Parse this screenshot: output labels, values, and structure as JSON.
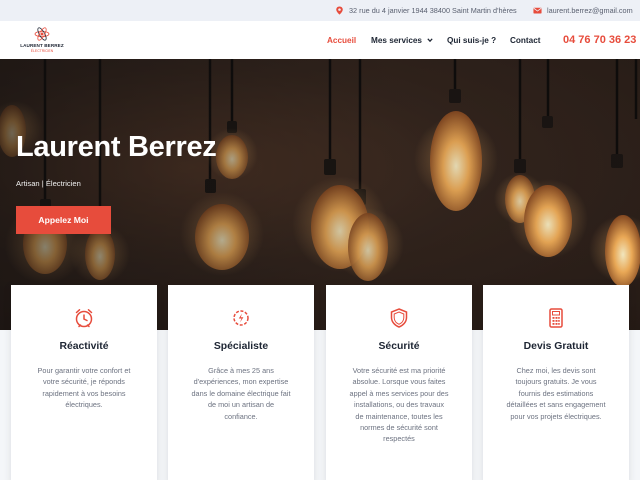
{
  "topbar": {
    "address": "32 rue du 4 janvier 1944 38400 Saint Martin d'hères",
    "email": "laurent.berrez@gmail.com"
  },
  "logo": {
    "name": "LAURENT BERREZ",
    "tagline": "ÉLECTRICIEN"
  },
  "nav": {
    "home": "Accueil",
    "services": "Mes services",
    "about": "Qui suis-je ?",
    "contact": "Contact",
    "phone": "04 76 70 36 23"
  },
  "hero": {
    "title": "Laurent Berrez",
    "subtitle": "Artisan | Électricien",
    "cta": "Appelez Moi"
  },
  "cards": [
    {
      "icon": "alarm-clock-icon",
      "title": "Réactivité",
      "text": "Pour garantir votre confort et votre sécurité, je réponds rapidement à vos besoins électriques."
    },
    {
      "icon": "power-gear-icon",
      "title": "Spécialiste",
      "text": "Grâce à mes 25 ans d'expériences, mon expertise dans le domaine électrique fait de moi un artisan de confiance."
    },
    {
      "icon": "shield-icon",
      "title": "Sécurité",
      "text": "Votre sécurité est ma priorité absolue. Lorsque vous faites appel à mes services pour des installations, ou des travaux de maintenance, toutes les normes de sécurité sont respectés"
    },
    {
      "icon": "calculator-icon",
      "title": "Devis Gratuit",
      "text": "Chez moi, les devis sont toujours gratuits. Je vous fournis des estimations détaillées et sans engagement pour vos projets électriques."
    }
  ],
  "colors": {
    "accent": "#e74c3c",
    "dark": "#1d2533",
    "topbar": "#edf0f6"
  }
}
